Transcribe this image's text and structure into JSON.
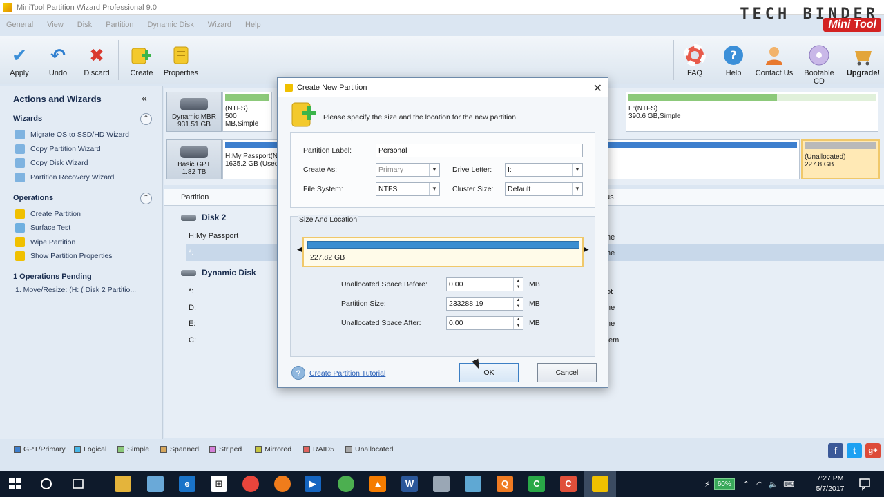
{
  "window": {
    "title": "MiniTool Partition Wizard Professional 9.0"
  },
  "branding": {
    "channel": "TECH BINDER",
    "logo": "Mini Tool"
  },
  "menu": [
    "General",
    "View",
    "Disk",
    "Partition",
    "Dynamic Disk",
    "Wizard",
    "Help"
  ],
  "toolbar": {
    "left": [
      {
        "label": "Apply",
        "icon": "check-icon"
      },
      {
        "label": "Undo",
        "icon": "undo-icon"
      },
      {
        "label": "Discard",
        "icon": "discard-icon"
      },
      {
        "label": "Create",
        "icon": "create-icon"
      },
      {
        "label": "Properties",
        "icon": "properties-icon"
      }
    ],
    "right": [
      {
        "label": "FAQ",
        "icon": "lifebuoy-icon"
      },
      {
        "label": "Help",
        "icon": "help-icon"
      },
      {
        "label": "Contact Us",
        "icon": "contact-icon"
      },
      {
        "label": "Bootable CD",
        "icon": "cd-icon"
      },
      {
        "label": "Upgrade!",
        "icon": "upgrade-icon"
      }
    ]
  },
  "sidebar": {
    "title": "Actions and Wizards",
    "collapse": "«",
    "wizards_title": "Wizards",
    "wizards": [
      "Migrate OS to SSD/HD Wizard",
      "Copy Partition Wizard",
      "Copy Disk Wizard",
      "Partition Recovery Wizard"
    ],
    "operations_title": "Operations",
    "operations": [
      "Create Partition",
      "Surface Test",
      "Wipe Partition",
      "Show Partition Properties"
    ],
    "pending_title": "1 Operations Pending",
    "pending_items": [
      "1. Move/Resize: (H: ( Disk 2 Partitio..."
    ]
  },
  "diskmap": {
    "disk1": {
      "type": "Dynamic MBR",
      "size": "931.51 GB"
    },
    "disk1_partitions": [
      {
        "name": "(NTFS)",
        "info": "500 MB,Simple"
      },
      {
        "name": "E:(NTFS)",
        "info": "390.6 GB,Simple"
      }
    ],
    "disk2": {
      "type": "Basic GPT",
      "size": "1.82 TB"
    },
    "disk2_partitions": [
      {
        "name": "H:My Passport(N",
        "info": "1635.2 GB (Used"
      },
      {
        "name": "(Unallocated)",
        "info": "227.8 GB"
      }
    ]
  },
  "partition_list": {
    "headers": [
      "Partition",
      "tus"
    ],
    "groups": [
      {
        "name": "Disk 2",
        "rows": [
          {
            "name": "H:My Passport",
            "status": "ne"
          },
          {
            "name": "*:",
            "status": "ne"
          }
        ]
      },
      {
        "name": "Dynamic Disk",
        "rows": [
          {
            "name": "*:",
            "status": "ot"
          },
          {
            "name": "D:",
            "status": "ne"
          },
          {
            "name": "E:",
            "status": "ne"
          },
          {
            "name": "C:",
            "status": "tem"
          }
        ]
      }
    ]
  },
  "legend": [
    "GPT/Primary",
    "Logical",
    "Simple",
    "Spanned",
    "Striped",
    "Mirrored",
    "RAID5",
    "Unallocated"
  ],
  "legend_colors": [
    "#3d7fce",
    "#46b6e8",
    "#8cc97a",
    "#d6a75d",
    "#d57fd8",
    "#c6c640",
    "#e0635e",
    "#a8a8a8"
  ],
  "dialog": {
    "title": "Create New Partition",
    "description": "Please specify the size and the location for the new partition.",
    "partition_label_label": "Partition Label:",
    "partition_label_value": "Personal",
    "create_as_label": "Create As:",
    "create_as_value": "Primary",
    "drive_letter_label": "Drive Letter:",
    "drive_letter_value": "I:",
    "file_system_label": "File System:",
    "file_system_value": "NTFS",
    "cluster_size_label": "Cluster Size:",
    "cluster_size_value": "Default",
    "size_location_title": "Size And Location",
    "slider_size": "227.82 GB",
    "unalloc_before_label": "Unallocated Space Before:",
    "unalloc_before_value": "0.00",
    "partition_size_label": "Partition Size:",
    "partition_size_value": "233288.19",
    "unalloc_after_label": "Unallocated Space After:",
    "unalloc_after_value": "0.00",
    "unit": "MB",
    "tutorial_link": "Create Partition Tutorial",
    "ok": "OK",
    "cancel": "Cancel"
  },
  "taskbar": {
    "battery": "60%",
    "time": "7:27 PM",
    "date": "5/7/2017"
  },
  "social": [
    "f",
    "t",
    "g+"
  ]
}
